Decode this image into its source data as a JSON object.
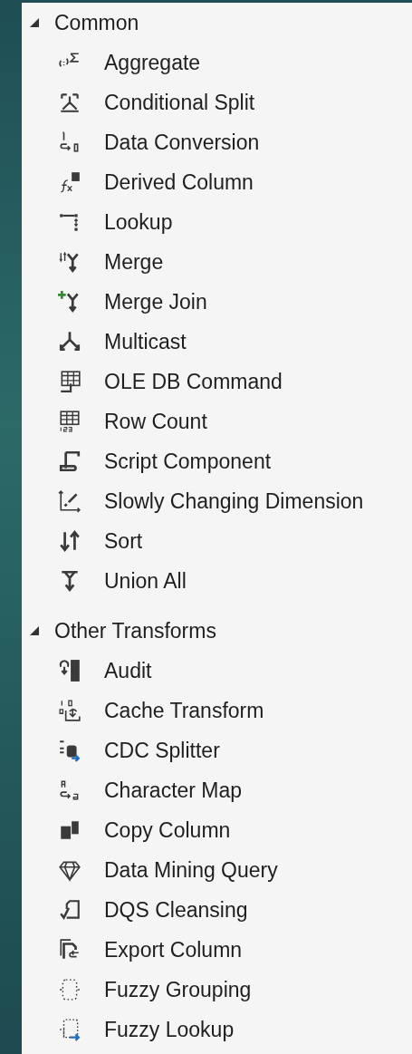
{
  "groups": [
    {
      "label": "Common",
      "expanded": true,
      "items": [
        {
          "label": "Aggregate"
        },
        {
          "label": "Conditional Split"
        },
        {
          "label": "Data Conversion"
        },
        {
          "label": "Derived Column"
        },
        {
          "label": "Lookup"
        },
        {
          "label": "Merge"
        },
        {
          "label": "Merge Join"
        },
        {
          "label": "Multicast"
        },
        {
          "label": "OLE DB Command"
        },
        {
          "label": "Row Count"
        },
        {
          "label": "Script Component"
        },
        {
          "label": "Slowly Changing Dimension"
        },
        {
          "label": "Sort"
        },
        {
          "label": "Union All"
        }
      ]
    },
    {
      "label": "Other Transforms",
      "expanded": true,
      "items": [
        {
          "label": "Audit"
        },
        {
          "label": "Cache Transform"
        },
        {
          "label": "CDC Splitter"
        },
        {
          "label": "Character Map"
        },
        {
          "label": "Copy Column"
        },
        {
          "label": "Data Mining Query"
        },
        {
          "label": "DQS Cleansing"
        },
        {
          "label": "Export Column"
        },
        {
          "label": "Fuzzy Grouping"
        },
        {
          "label": "Fuzzy Lookup"
        }
      ]
    }
  ]
}
